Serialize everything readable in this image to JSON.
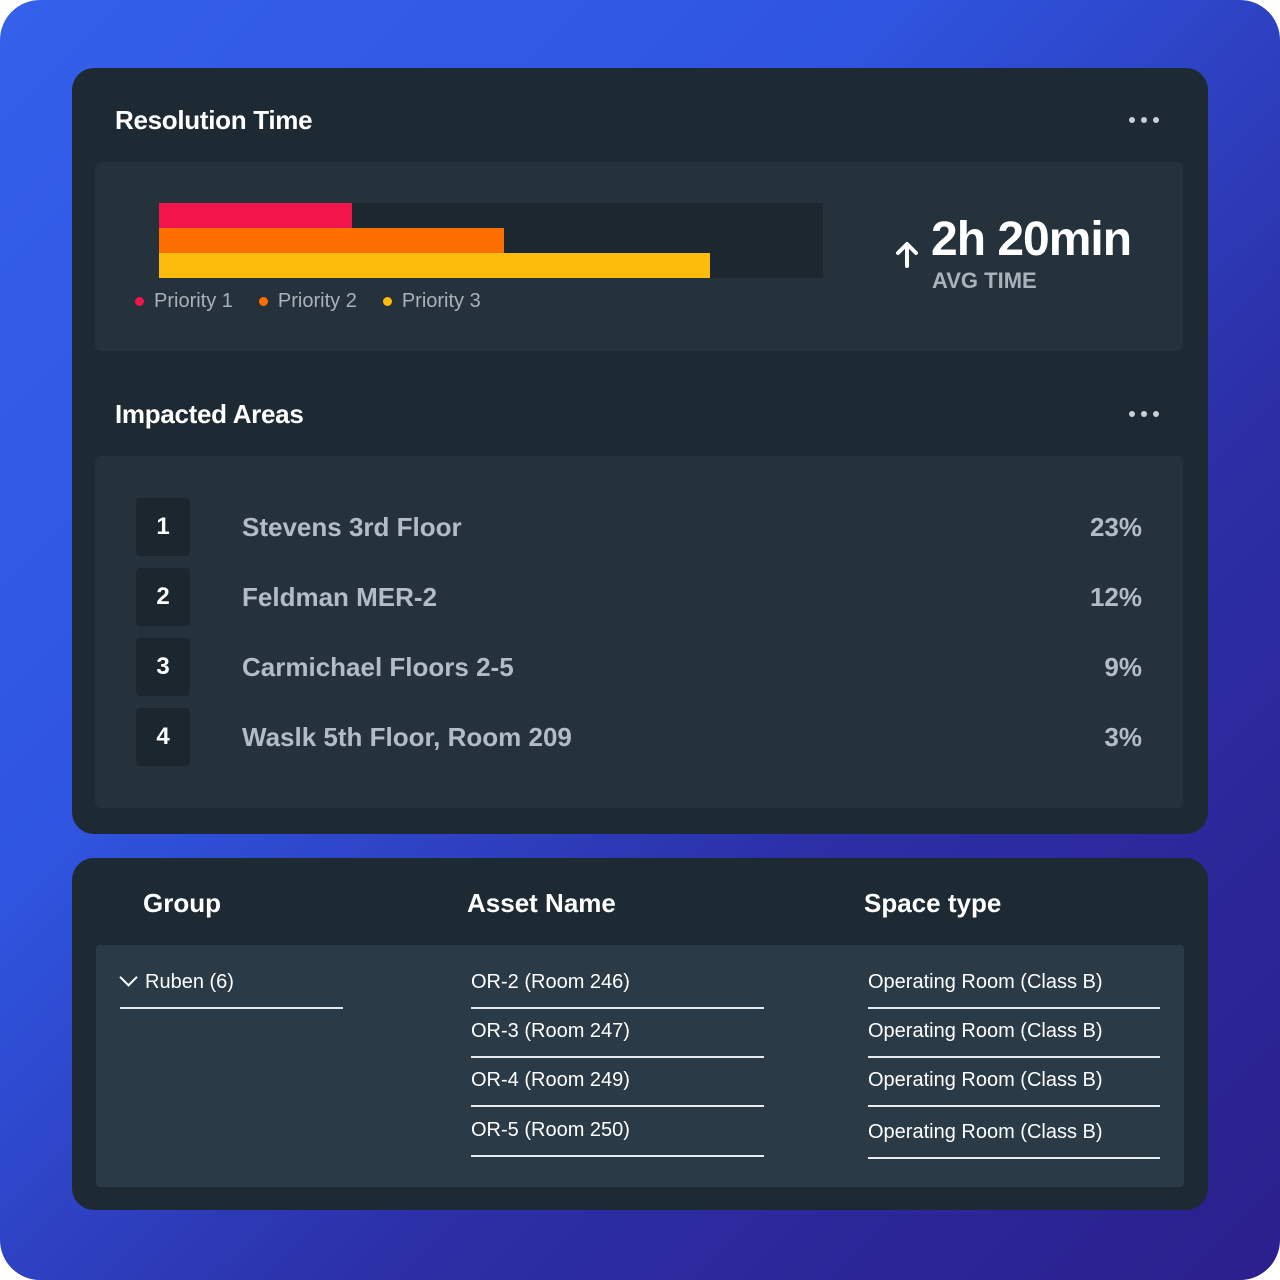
{
  "resolution": {
    "title": "Resolution Time",
    "bars": [
      {
        "name": "Priority 1",
        "fraction": 0.29,
        "color": "#f1154b"
      },
      {
        "name": "Priority 2",
        "fraction": 0.52,
        "color": "#fe6f00"
      },
      {
        "name": "Priority 3",
        "fraction": 0.83,
        "color": "#fdbb0b"
      }
    ],
    "legend": [
      "Priority 1",
      "Priority 2",
      "Priority 3"
    ],
    "avg_value": "2h 20min",
    "avg_label": "AVG TIME"
  },
  "impacted": {
    "title": "Impacted Areas",
    "rows": [
      {
        "rank": "1",
        "name": "Stevens 3rd Floor",
        "pct": "23%"
      },
      {
        "rank": "2",
        "name": "Feldman MER-2",
        "pct": "12%"
      },
      {
        "rank": "3",
        "name": "Carmichael Floors 2-5",
        "pct": "9%"
      },
      {
        "rank": "4",
        "name": "Waslk 5th Floor, Room 209",
        "pct": "3%"
      }
    ]
  },
  "table": {
    "headers": {
      "group": "Group",
      "asset": "Asset Name",
      "space": "Space type"
    },
    "group": "Ruben (6)",
    "assets": [
      "OR-2 (Room 246)",
      "OR-3 (Room 247)",
      "OR-4 (Room 249)",
      "OR-5 (Room 250)"
    ],
    "spaces": [
      "Operating Room (Class B)",
      "Operating Room (Class B)",
      "Operating Room (Class B)",
      "Operating Room (Class B)"
    ]
  }
}
